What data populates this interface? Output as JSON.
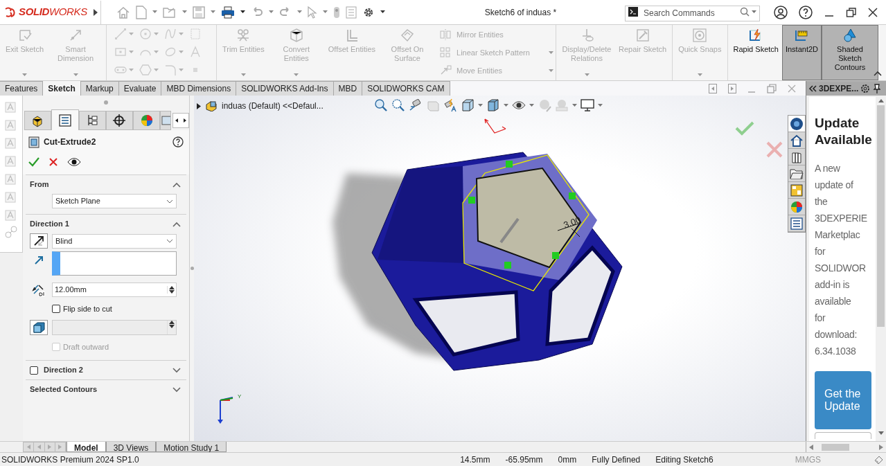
{
  "titlebar": {
    "logo": "**SOLID**WORKS",
    "title": "Sketch6 of induas *",
    "search_placeholder": "Search Commands"
  },
  "ribbon": [
    {
      "items": [
        {
          "kind": "large",
          "label": "Exit Sketch",
          "disabled": true,
          "dropdown": true
        },
        {
          "kind": "large",
          "label": "Smart Dimension",
          "disabled": true,
          "dropdown": true
        }
      ]
    },
    {
      "items": [
        {
          "kind": "sketch_grid",
          "disabled": true
        }
      ]
    },
    {
      "items": [
        {
          "kind": "large",
          "label": "Trim Entities",
          "disabled": true,
          "dropdown": true
        },
        {
          "kind": "large",
          "label": "Convert Entities",
          "disabled": true,
          "dropdown": true
        },
        {
          "kind": "large",
          "label": "Offset Entities",
          "disabled": true,
          "dropdown": false
        },
        {
          "kind": "large",
          "label": "Offset On Surface",
          "disabled": true,
          "dropdown": false
        },
        {
          "kind": "small_list",
          "disabled": true,
          "items": [
            {
              "label": "Mirror Entities",
              "dropdown": false
            },
            {
              "label": "Linear Sketch Pattern",
              "dropdown": true
            },
            {
              "label": "Move Entities",
              "dropdown": true
            }
          ]
        }
      ]
    },
    {
      "items": [
        {
          "kind": "large",
          "label": "Display/Delete Relations",
          "disabled": true,
          "dropdown": true
        },
        {
          "kind": "large",
          "label": "Repair Sketch",
          "disabled": true,
          "dropdown": false
        }
      ]
    },
    {
      "items": [
        {
          "kind": "large",
          "label": "Quick Snaps",
          "disabled": true,
          "dropdown": true
        }
      ]
    },
    {
      "items": [
        {
          "kind": "large",
          "label": "Rapid Sketch",
          "disabled": false,
          "dropdown": false,
          "on": false
        },
        {
          "kind": "large",
          "label": "Instant2D",
          "disabled": false,
          "dropdown": false,
          "on": true
        },
        {
          "kind": "large",
          "label": "Shaded Sketch Contours",
          "disabled": false,
          "dropdown": false,
          "on": true
        }
      ]
    }
  ],
  "command_tabs": [
    {
      "label": "Features",
      "selected": false
    },
    {
      "label": "Sketch",
      "selected": true
    },
    {
      "label": "Markup",
      "selected": false
    },
    {
      "label": "Evaluate",
      "selected": false
    },
    {
      "label": "MBD Dimensions",
      "selected": false
    },
    {
      "label": "SOLIDWORKS Add-Ins",
      "selected": false
    },
    {
      "label": "MBD",
      "selected": false
    },
    {
      "label": "SOLIDWORKS CAM",
      "selected": false
    }
  ],
  "property_manager": {
    "tabs": [
      {
        "selected": false
      },
      {
        "selected": true
      },
      {
        "selected": false
      },
      {
        "selected": false
      },
      {
        "selected": false
      },
      {
        "selected": false
      }
    ],
    "title": "Cut-Extrude2",
    "from": {
      "label": "From",
      "expanded": true,
      "value": "Sketch Plane"
    },
    "direction1": {
      "label": "Direction 1",
      "expanded": true,
      "end_condition": "Blind",
      "depth": "12.00mm",
      "flip": {
        "label": "Flip side to cut",
        "checked": false
      },
      "draft_outward": {
        "label": "Draft outward",
        "checked": false,
        "disabled": true
      }
    },
    "direction2": {
      "label": "Direction 2",
      "checked": false,
      "expanded": false
    },
    "selected_contours": {
      "label": "Selected Contours",
      "expanded": false
    }
  },
  "viewport": {
    "tree_label": "induas (Default) <<Defaul...",
    "dimension": "3.00",
    "triad_label": "Y"
  },
  "task_pane": {
    "title": "3DEXPE...",
    "heading": "Update Available",
    "body_lines": [
      "A new",
      "update of",
      "the",
      "3DEXPERIE",
      "Marketplac",
      "for",
      "SOLIDWOR",
      "add-in is",
      "available",
      "for",
      "download:",
      "6.34.1038"
    ],
    "button": "Get the Update"
  },
  "bottom_tabs": [
    {
      "label": "Model",
      "selected": true
    },
    {
      "label": "3D Views",
      "selected": false
    },
    {
      "label": "Motion Study 1",
      "selected": false
    }
  ],
  "status_bar": {
    "product": "SOLIDWORKS Premium 2024 SP1.0",
    "x": "14.5mm",
    "y": "-65.95mm",
    "z": "0mm",
    "state": "Fully Defined",
    "mode": "Editing Sketch6",
    "units": "MMGS"
  }
}
